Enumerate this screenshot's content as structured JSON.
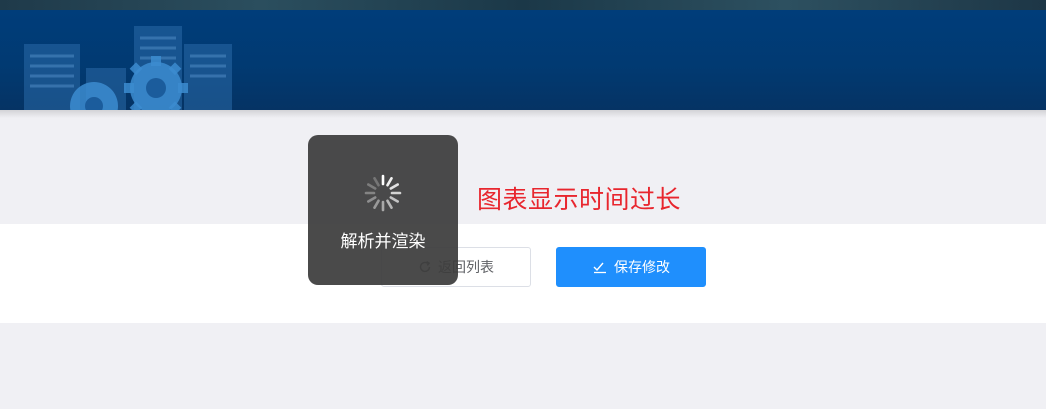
{
  "header": {
    "banner_icons": [
      "server-building-icon",
      "gear-icon"
    ],
    "background_color": "#013a72"
  },
  "message": {
    "text": "图表显示时间过长",
    "color": "#e8262e"
  },
  "actions": {
    "back_label": "返回列表",
    "back_icon": "refresh-icon",
    "save_label": "保存修改",
    "save_icon": "check-edit-icon",
    "save_color": "#1f8ffd"
  },
  "loading": {
    "text": "解析并渲染",
    "icon": "spinner-icon"
  }
}
